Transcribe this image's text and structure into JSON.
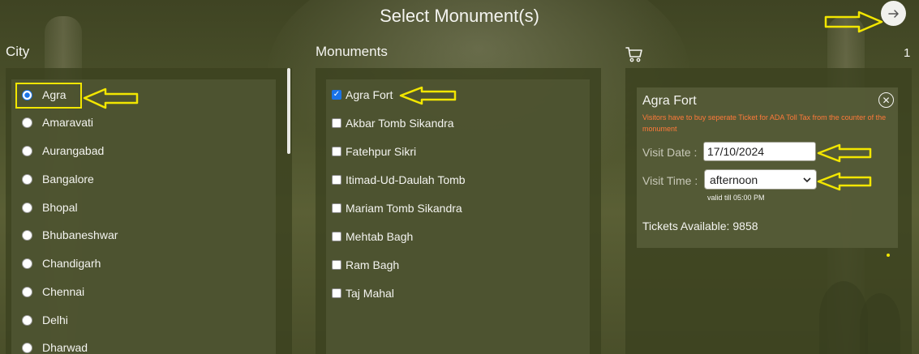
{
  "page": {
    "title": "Select Monument(s)"
  },
  "header": {
    "next_icon": "arrow-right-icon"
  },
  "city_column": {
    "title": "City",
    "cities": [
      {
        "label": "Agra",
        "selected": true
      },
      {
        "label": "Amaravati",
        "selected": false
      },
      {
        "label": "Aurangabad",
        "selected": false
      },
      {
        "label": "Bangalore",
        "selected": false
      },
      {
        "label": "Bhopal",
        "selected": false
      },
      {
        "label": "Bhubaneshwar",
        "selected": false
      },
      {
        "label": "Chandigarh",
        "selected": false
      },
      {
        "label": "Chennai",
        "selected": false
      },
      {
        "label": "Delhi",
        "selected": false
      },
      {
        "label": "Dharwad",
        "selected": false
      }
    ]
  },
  "monuments_column": {
    "title": "Monuments",
    "monuments": [
      {
        "label": "Agra Fort",
        "checked": true
      },
      {
        "label": "Akbar Tomb Sikandra",
        "checked": false
      },
      {
        "label": "Fatehpur Sikri",
        "checked": false
      },
      {
        "label": "Itimad-Ud-Daulah Tomb",
        "checked": false
      },
      {
        "label": "Mariam Tomb Sikandra",
        "checked": false
      },
      {
        "label": "Mehtab Bagh",
        "checked": false
      },
      {
        "label": "Ram Bagh",
        "checked": false
      },
      {
        "label": "Taj Mahal",
        "checked": false
      }
    ]
  },
  "cart": {
    "icon": "cart-icon",
    "count": "1",
    "item": {
      "title": "Agra Fort",
      "note": "Visitors have to buy seperate Ticket for ADA Toll Tax from the counter of the monument",
      "visit_date_label": "Visit Date :",
      "visit_date_value": "17/10/2024",
      "visit_time_label": "Visit Time :",
      "visit_time_value": "afternoon",
      "valid_note": "valid till 05:00 PM",
      "tickets_label": "Tickets Available:",
      "tickets_value": "9858"
    }
  },
  "colors": {
    "annotation": "#f2e600",
    "warning_text": "#ff7a3a",
    "selection_blue": "#1a73e8"
  }
}
